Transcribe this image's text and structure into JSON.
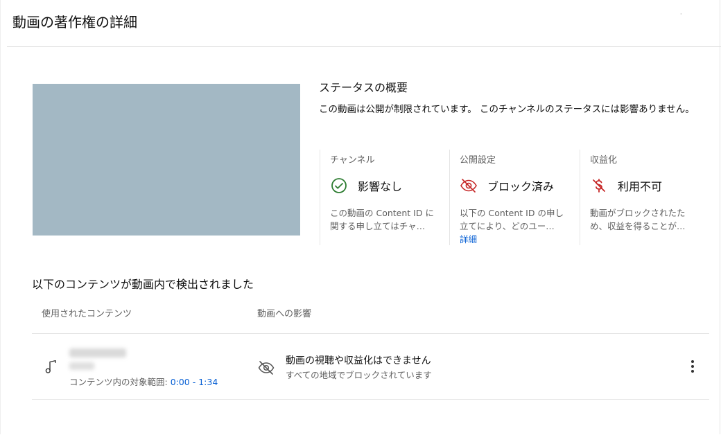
{
  "header": {
    "title": "動画の著作権の詳細"
  },
  "status": {
    "heading": "ステータスの概要",
    "description": "この動画は公開が制限されています。 このチャンネルのステータスには影響ありません。"
  },
  "cards": [
    {
      "label": "チャンネル",
      "value": "影響なし",
      "icon": "check-circle-icon",
      "desc": "この動画の Content ID に関する申し立てはチャ…"
    },
    {
      "label": "公開設定",
      "value": "ブロック済み",
      "icon": "eye-off-icon",
      "desc": "以下の Content ID の申し立てにより、どのユー…",
      "link": "詳細"
    },
    {
      "label": "収益化",
      "value": "利用不可",
      "icon": "money-off-icon",
      "desc": "動画がブロックされたため、収益を得ることが…"
    }
  ],
  "detected": {
    "heading": "以下のコンテンツが動画内で検出されました",
    "columns": {
      "content": "使用されたコンテンツ",
      "impact": "動画への影響"
    },
    "rows": [
      {
        "content_icon": "music-note-icon",
        "range_label": "コンテンツ内の対象範囲: ",
        "range_value": "0:00 - 1:34",
        "impact_icon": "eye-off-icon",
        "impact_title": "動画の視聴や収益化はできません",
        "impact_sub": "すべての地域でブロックされています"
      }
    ]
  },
  "colors": {
    "success": "#2e7d32",
    "error": "#c62828",
    "link": "#065fd4",
    "thumbnail": "#a3b8c4"
  }
}
